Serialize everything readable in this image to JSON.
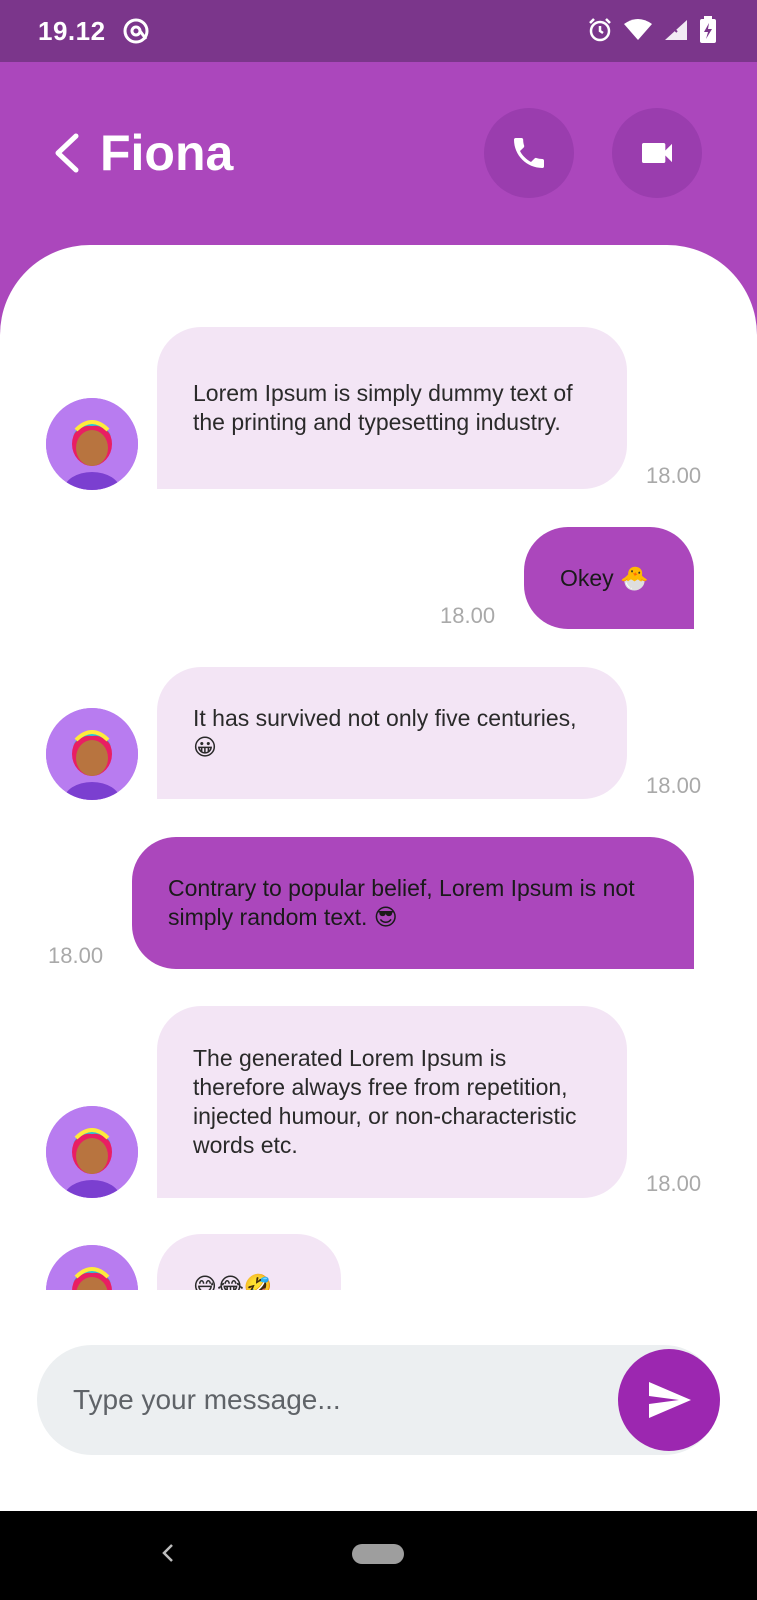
{
  "status_bar": {
    "time": "19.12",
    "icons": [
      "at-sign-icon",
      "alarm-icon",
      "wifi-icon",
      "signal-icon",
      "battery-charging-icon"
    ]
  },
  "header": {
    "contact_name": "Fiona",
    "icons": [
      "back-chevron-icon",
      "phone-icon",
      "video-camera-icon"
    ]
  },
  "messages": [
    {
      "direction": "incoming",
      "text": "Lorem Ipsum is simply dummy text of the printing and typesetting industry.",
      "time": "18.00"
    },
    {
      "direction": "outgoing",
      "text": "Okey 🐣",
      "time": "18.00"
    },
    {
      "direction": "incoming",
      "text": "It has survived not only five centuries, 😀",
      "time": "18.00"
    },
    {
      "direction": "outgoing",
      "text": "Contrary to popular belief, Lorem Ipsum is not simply random text. 😎",
      "time": "18.00"
    },
    {
      "direction": "incoming",
      "text": "The generated Lorem Ipsum is therefore always free from repetition, injected humour, or non-characteristic words etc.",
      "time": "18.00"
    },
    {
      "direction": "incoming",
      "text": "😅😂🤣",
      "time": ""
    }
  ],
  "composer": {
    "placeholder": "Type your message...",
    "send_icon": "send-icon"
  },
  "colors": {
    "header": "#ab47bc",
    "status_bar": "#7b368b",
    "incoming_bubble": "#f3e5f5",
    "outgoing_bubble": "#ab47bc",
    "send_button": "#9c27b0"
  }
}
